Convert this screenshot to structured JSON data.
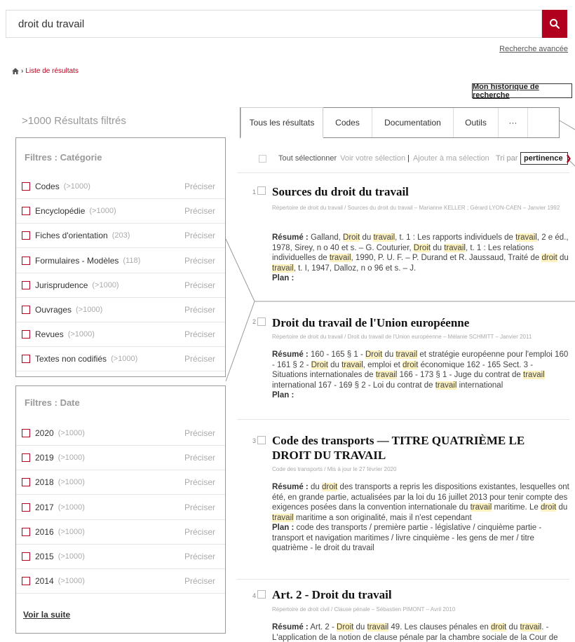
{
  "search": {
    "value": "droit du travail"
  },
  "header": {
    "advanced_search": "Recherche avancée"
  },
  "breadcrumb": {
    "label": "Liste de résultats"
  },
  "history_button": "Mon historique de recherche",
  "results_count": ">1000 Résultats filtrés",
  "filters": {
    "category": {
      "title": "Filtres : Catégorie",
      "items": [
        {
          "label": "Codes",
          "count": "(>1000)",
          "action": "Préciser"
        },
        {
          "label": "Encyclopédie",
          "count": "(>1000)",
          "action": "Préciser"
        },
        {
          "label": "Fiches d'orientation",
          "count": "(203)",
          "action": "Préciser"
        },
        {
          "label": "Formulaires - Modèles",
          "count": "(118)",
          "action": "Préciser"
        },
        {
          "label": "Jurisprudence",
          "count": "(>1000)",
          "action": "Préciser"
        },
        {
          "label": "Ouvrages",
          "count": "(>1000)",
          "action": "Préciser"
        },
        {
          "label": "Revues",
          "count": "(>1000)",
          "action": "Préciser"
        },
        {
          "label": "Textes non codifiés",
          "count": "(>1000)",
          "action": "Préciser"
        }
      ]
    },
    "date": {
      "title": "Filtres : Date",
      "items": [
        {
          "label": "2020",
          "count": "(>1000)",
          "action": "Préciser"
        },
        {
          "label": "2019",
          "count": "(>1000)",
          "action": "Préciser"
        },
        {
          "label": "2018",
          "count": "(>1000)",
          "action": "Préciser"
        },
        {
          "label": "2017",
          "count": "(>1000)",
          "action": "Préciser"
        },
        {
          "label": "2016",
          "count": "(>1000)",
          "action": "Préciser"
        },
        {
          "label": "2015",
          "count": "(>1000)",
          "action": "Préciser"
        },
        {
          "label": "2014",
          "count": "(>1000)",
          "action": "Préciser"
        }
      ],
      "more": "Voir la suite"
    }
  },
  "tabs": [
    {
      "label": "Tous les résultats"
    },
    {
      "label": "Codes"
    },
    {
      "label": "Documentation"
    },
    {
      "label": "Outils"
    },
    {
      "label": "···"
    }
  ],
  "selection": {
    "select_all": "Tout sélectionner",
    "view_selection": "Voir votre sélection",
    "add_selection": "Ajouter à ma sélection",
    "sort_label": "Tri par :",
    "sort_value": "pertinence"
  },
  "results": [
    {
      "num": "1",
      "title": "Sources du droit du travail",
      "meta": "Répertoire de droit du travail / Sources du droit du travail – Marianne KELLER ; Gérard LYON-CAEN – Janvier 1992",
      "summary_label": "Résumé :",
      "summary": "Galland, Droit du travail, t. 1 : Les rapports individuels de travail, 2 e éd., 1978, Sirey, n o 40 et s. – G. Couturier, Droit du travail, t. 1 : Les relations individuelles de travail, 1990, P. U. F. – P. Durand et R. Jaussaud, Traité de droit du travail, t. I, 1947, Dalloz, n o 96 et s. – J.",
      "plan_label": "Plan :",
      "plan": ""
    },
    {
      "num": "2",
      "title": "Droit du travail de l'Union européenne",
      "meta": "Répertoire de droit du travail / Droit du travail de l'Union européenne – Mélanie SCHMITT – Janvier 2011",
      "summary_label": "Résumé :",
      "summary": "160 - 165 §  1 - Droit du travail et stratégie européenne pour l'emploi 160 - 161 §  2 - Droit du travail, emploi et droit économique 162 - 165 Sect.  3 - Situations internationales de travail 166 - 173 §  1 - Juge du contrat de travail international 167 - 169 §  2 - Loi du contrat de travail international",
      "plan_label": "Plan :",
      "plan": ""
    },
    {
      "num": "3",
      "title": "Code des transports — TITRE QUATRIÈME LE DROIT DU TRAVAIL",
      "meta": "Code des transports / Mis à jour le 27 février 2020",
      "summary_label": "Résumé :",
      "summary": "du droit des transports a repris les dispositions existantes, lesquelles ont été, en grande partie, actualisées par la loi du 16 juillet 2013 pour tenir compte des exigences posées dans la convention internationale du travail maritime. Le droit du travail maritime a son originalité, mais il n'est cependant",
      "plan_label": "Plan :",
      "plan": "code des transports / première partie - législative / cinquième partie - transport et navigation maritimes / livre cinquième - les gens de mer / titre quatrième - le droit du travail"
    },
    {
      "num": "4",
      "title": "Art. 2 - Droit du travail",
      "meta": "Répertoire de droit civil / Clause pénale – Sébastien PIMONT – Avril 2010",
      "summary_label": "Résumé :",
      "summary": "Art.  2 - Droit du travail 49.  Les clauses pénales en droit du travail. - L'application de la notion de clause pénale par la chambre sociale de la Cour de",
      "plan_label": "",
      "plan": ""
    }
  ],
  "highlight_terms": [
    "Droit",
    "droit",
    "travail"
  ],
  "colors": {
    "accent": "#b1001d",
    "highlight": "#fdf2c0"
  },
  "icons": {
    "search": "search-icon",
    "home": "home-icon",
    "chevron": "chevron-down-icon"
  }
}
